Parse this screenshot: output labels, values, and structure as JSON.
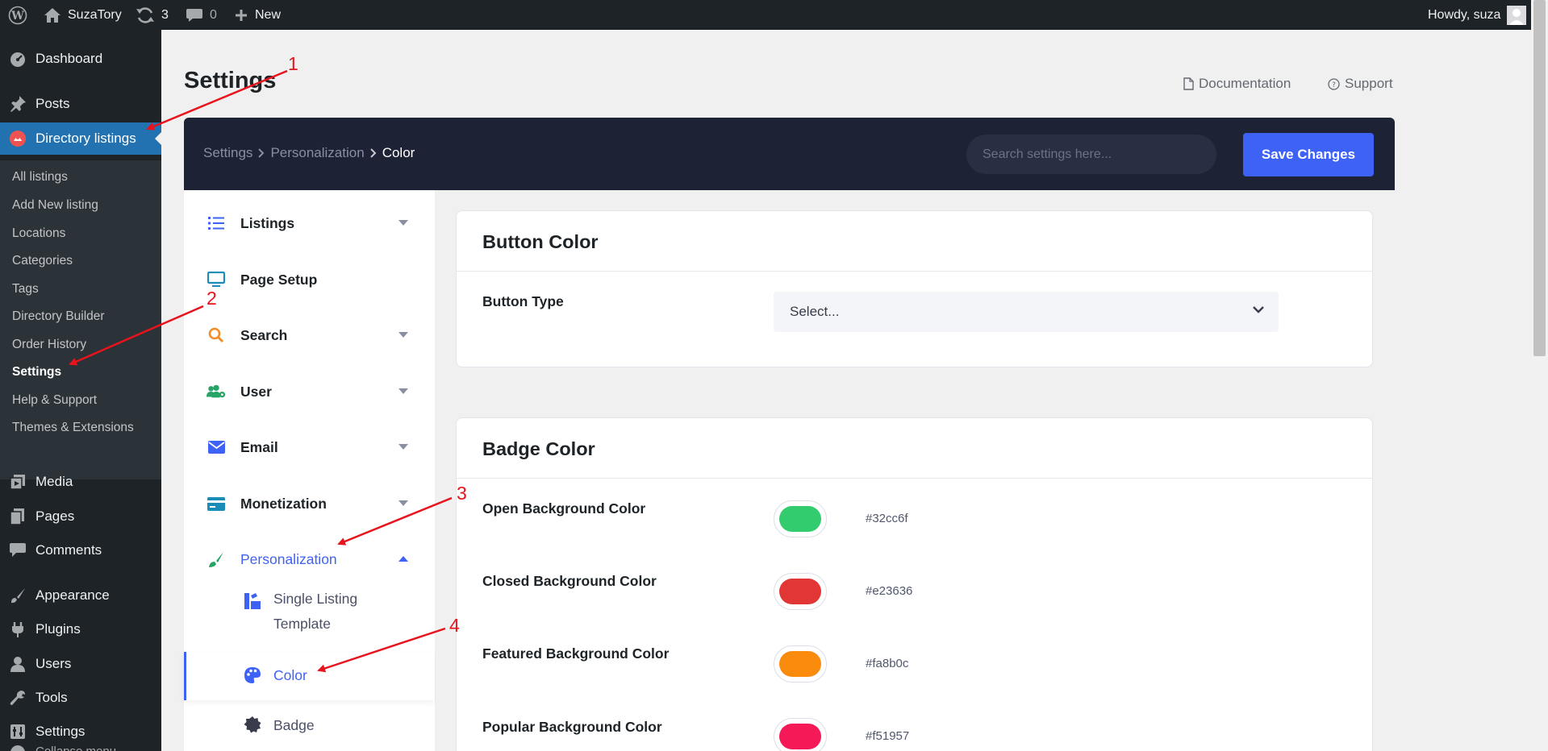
{
  "adminbar": {
    "site_name": "SuzaTory",
    "updates_count": "3",
    "comments_count": "0",
    "new_label": "New",
    "howdy": "Howdy, suza"
  },
  "admin_menu": {
    "dashboard": "Dashboard",
    "posts": "Posts",
    "directory_listings": "Directory listings",
    "submenu": [
      "All listings",
      "Add New listing",
      "Locations",
      "Categories",
      "Tags",
      "Directory Builder",
      "Order History",
      "Settings",
      "Help & Support",
      "Themes & Extensions"
    ],
    "media": "Media",
    "pages": "Pages",
    "comments": "Comments",
    "appearance": "Appearance",
    "plugins": "Plugins",
    "users": "Users",
    "tools": "Tools",
    "settings": "Settings",
    "collapse": "Collapse menu"
  },
  "page": {
    "title": "Settings",
    "documentation": "Documentation",
    "support": "Support"
  },
  "settings_header": {
    "breadcrumb": [
      "Settings",
      "Personalization",
      "Color"
    ],
    "search_placeholder": "Search settings here...",
    "save_label": "Save Changes",
    "accent": "#3e62f5"
  },
  "settings_nav": {
    "items": [
      {
        "label": "Listings",
        "icon": "list-icon",
        "expandable": true
      },
      {
        "label": "Page Setup",
        "icon": "monitor-icon",
        "expandable": false
      },
      {
        "label": "Search",
        "icon": "search-icon",
        "expandable": true
      },
      {
        "label": "User",
        "icon": "users-gear-icon",
        "expandable": true
      },
      {
        "label": "Email",
        "icon": "envelope-icon",
        "expandable": true
      },
      {
        "label": "Monetization",
        "icon": "credit-card-icon",
        "expandable": true
      },
      {
        "label": "Personalization",
        "icon": "brush-icon",
        "expandable": true,
        "open": true
      }
    ],
    "sub_items": [
      {
        "label_line1": "Single Listing",
        "label_line2": "Template",
        "icon": "template-icon"
      },
      {
        "label": "Color",
        "icon": "palette-icon",
        "active": true
      },
      {
        "label": "Badge",
        "icon": "badge-icon"
      }
    ]
  },
  "button_color": {
    "title": "Button Color",
    "button_type_label": "Button Type",
    "button_type_value": "Select..."
  },
  "badge_color": {
    "title": "Badge Color",
    "fields": [
      {
        "label": "Open Background Color",
        "hex": "#32cc6f"
      },
      {
        "label": "Closed Background Color",
        "hex": "#e23636"
      },
      {
        "label": "Featured Background Color",
        "hex": "#fa8b0c"
      },
      {
        "label": "Popular Background Color",
        "hex": "#f51957"
      }
    ]
  },
  "annotations": [
    "1",
    "2",
    "3",
    "4"
  ]
}
